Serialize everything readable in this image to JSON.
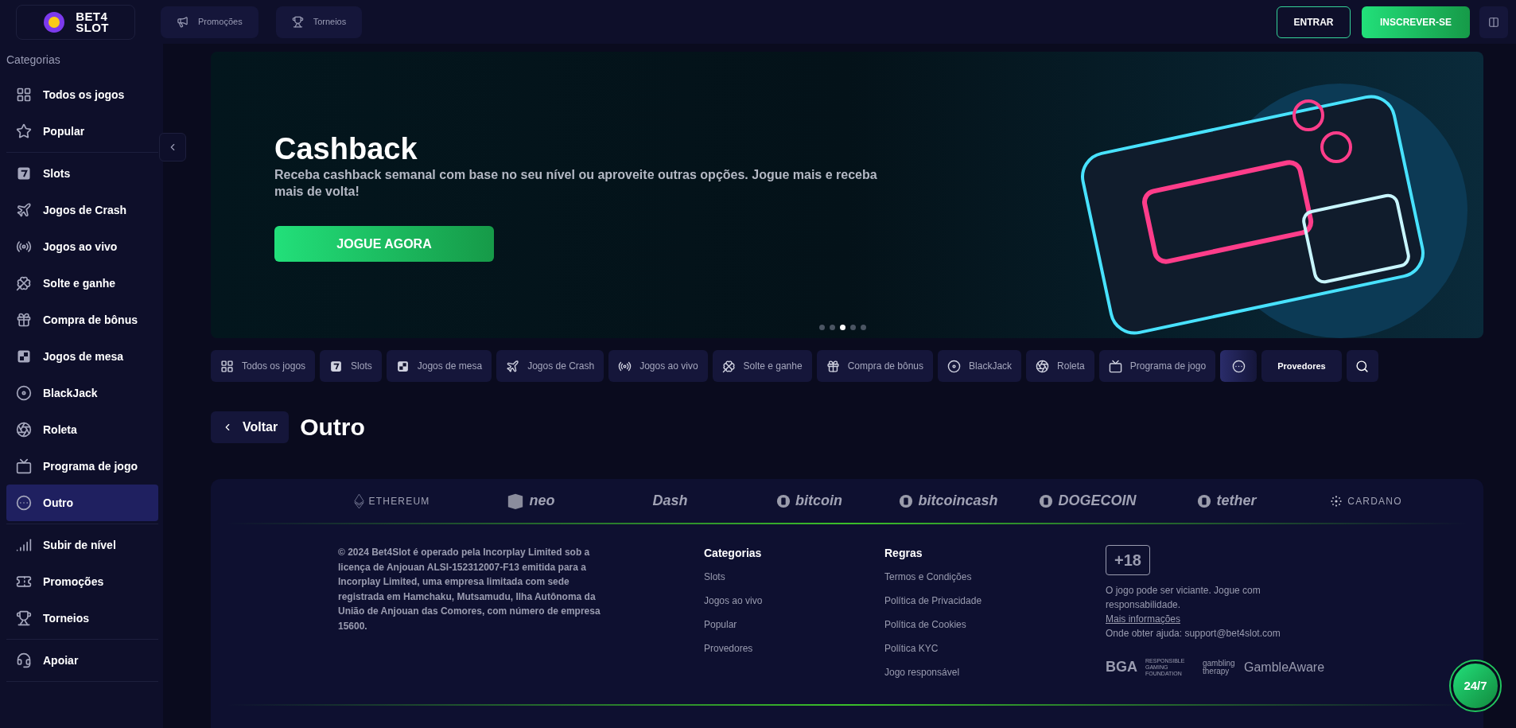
{
  "header": {
    "logo": {
      "line1": "BET4",
      "line2": "SLOT"
    },
    "nav": [
      {
        "label": "Promoções",
        "kind": "megaphone"
      },
      {
        "label": "Torneios",
        "kind": "trophy"
      }
    ],
    "login": "ENTRAR",
    "signup": "INSCREVER-SE"
  },
  "sidebar": {
    "title": "Categorias",
    "groups": [
      [
        {
          "label": "Todos os jogos",
          "kind": "grid",
          "selected": false
        },
        {
          "label": "Popular",
          "kind": "star",
          "selected": false
        }
      ],
      [
        {
          "label": "Slots",
          "kind": "slots",
          "selected": false
        },
        {
          "label": "Jogos de Crash",
          "kind": "plane",
          "selected": false
        },
        {
          "label": "Jogos ao vivo",
          "kind": "broadcast",
          "selected": false
        },
        {
          "label": "Solte e ganhe",
          "kind": "clover",
          "selected": false
        },
        {
          "label": "Compra de bônus",
          "kind": "gift",
          "selected": false
        },
        {
          "label": "Jogos de mesa",
          "kind": "board",
          "selected": false
        },
        {
          "label": "BlackJack",
          "kind": "chip",
          "selected": false
        },
        {
          "label": "Roleta",
          "kind": "roulette",
          "selected": false
        },
        {
          "label": "Programa de jogo",
          "kind": "live",
          "selected": false
        },
        {
          "label": "Outro",
          "kind": "dots",
          "selected": true
        }
      ],
      [
        {
          "label": "Subir de nível",
          "kind": "levels",
          "selected": false
        },
        {
          "label": "Promoções",
          "kind": "ticket",
          "selected": false
        },
        {
          "label": "Torneios",
          "kind": "trophy",
          "selected": false
        }
      ],
      [
        {
          "label": "Apoiar",
          "kind": "headset",
          "selected": false
        }
      ]
    ]
  },
  "banner": {
    "title": "Cashback",
    "text": "Receba cashback semanal com base no seu nível ou aproveite outras opções. Jogue mais e receba mais de volta!",
    "button": "JOGUE AGORA",
    "dots": [
      {
        "selected": false
      },
      {
        "selected": false
      },
      {
        "selected": true
      },
      {
        "selected": false
      },
      {
        "selected": false
      }
    ]
  },
  "category_bar": {
    "items": [
      {
        "label": "Todos os jogos",
        "kind": "grid",
        "selected": false
      },
      {
        "label": "Slots",
        "kind": "slots",
        "selected": false
      },
      {
        "label": "Jogos de mesa",
        "kind": "board",
        "selected": false
      },
      {
        "label": "Jogos de Crash",
        "kind": "plane",
        "selected": false
      },
      {
        "label": "Jogos ao vivo",
        "kind": "broadcast",
        "selected": false
      },
      {
        "label": "Solte e ganhe",
        "kind": "clover",
        "selected": false
      },
      {
        "label": "Compra de bônus",
        "kind": "gift",
        "selected": false
      },
      {
        "label": "BlackJack",
        "kind": "chip",
        "selected": false
      },
      {
        "label": "Roleta",
        "kind": "roulette",
        "selected": false
      },
      {
        "label": "Programa de jogo",
        "kind": "live",
        "selected": false
      },
      {
        "kind": "dots",
        "selected": true
      }
    ],
    "providers": "Provedores"
  },
  "section": {
    "back": "Voltar",
    "title": "Outro"
  },
  "footer": {
    "crypto": [
      {
        "name": "ETHEREUM",
        "kind": "diamond"
      },
      {
        "name": "neo",
        "kind": "cube"
      },
      {
        "name": "Dash",
        "kind": "plain"
      },
      {
        "name": "bitcoin",
        "kind": "coin"
      },
      {
        "name": "bitcoincash",
        "kind": "coin"
      },
      {
        "name": "DOGECOIN",
        "kind": "coin"
      },
      {
        "name": "tether",
        "kind": "coin"
      },
      {
        "name": "CARDANO",
        "kind": "star"
      }
    ],
    "legal": "© 2024 Bet4Slot é operado pela Incorplay Limited sob a licença de Anjouan ALSI-152312007-F13 emitida para a Incorplay Limited, uma empresa limitada com sede registrada em Hamchaku, Mutsamudu, Ilha Autônoma da União de Anjouan das Comores, com número de empresa 15600.",
    "columns": [
      {
        "title": "Categorias",
        "links": [
          "Slots",
          "Jogos ao vivo",
          "Popular",
          "Provedores"
        ]
      },
      {
        "title": "Regras",
        "links": [
          "Termos e Condições",
          "Política de Privacidade",
          "Política de Cookies",
          "Política KYC",
          "Jogo responsável"
        ]
      }
    ],
    "age": "+18",
    "warning": "O jogo pode ser viciante. Jogue com responsabilidade.",
    "more": "Mais informações",
    "help": "Onde obter ajuda: support@bet4slot.com",
    "orgs": [
      "BGA",
      "RESPONSIBLE GAMING FOUNDATION",
      "gambling therapy",
      "GambleAware"
    ]
  },
  "support": "24/7"
}
